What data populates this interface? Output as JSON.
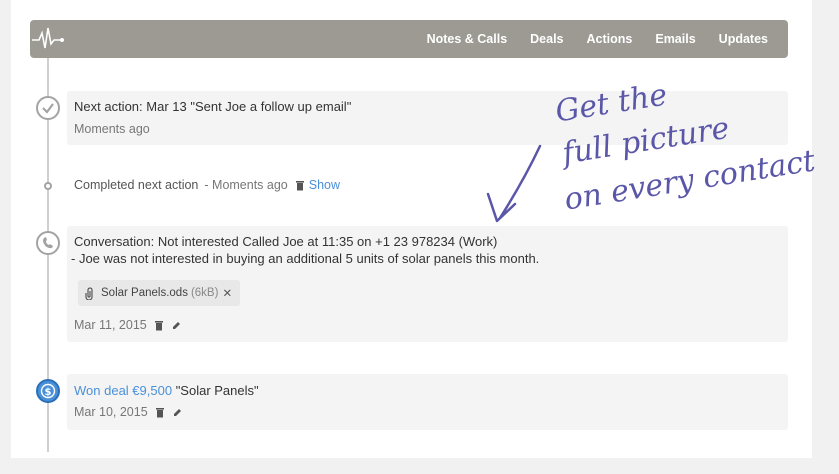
{
  "nav": {
    "items": [
      "Notes & Calls",
      "Deals",
      "Actions",
      "Emails",
      "Updates"
    ]
  },
  "entries": {
    "next_action": {
      "title": "Next action: Mar 13 \"Sent Joe a follow up email\"",
      "time": "Moments ago"
    },
    "completed": {
      "text": "Completed next action",
      "time": "- Moments ago",
      "show_label": "Show"
    },
    "conversation": {
      "title": "Conversation: Not interested Called Joe at 11:35 on +1 23 978234 (Work)",
      "body": "- Joe was not interested in buying an additional 5 units of solar panels this month.",
      "attachment_name": "Solar Panels.ods",
      "attachment_size": "(6kB)",
      "date": "Mar 11, 2015"
    },
    "deal": {
      "link": "Won deal €9,500",
      "name": "\"Solar Panels\"",
      "date": "Mar 10, 2015"
    }
  },
  "annotation": {
    "line1": "Get the",
    "line2": "full picture",
    "line3": "on every contact"
  },
  "colors": {
    "topbar": "#9c9a93",
    "accent": "#4a90d9",
    "annotation": "#5a56a8"
  },
  "icons": [
    "pulse-logo-icon",
    "checkmark-icon",
    "phone-icon",
    "dollar-icon",
    "trash-icon",
    "pencil-icon",
    "paperclip-icon",
    "close-icon",
    "arrow-icon"
  ]
}
